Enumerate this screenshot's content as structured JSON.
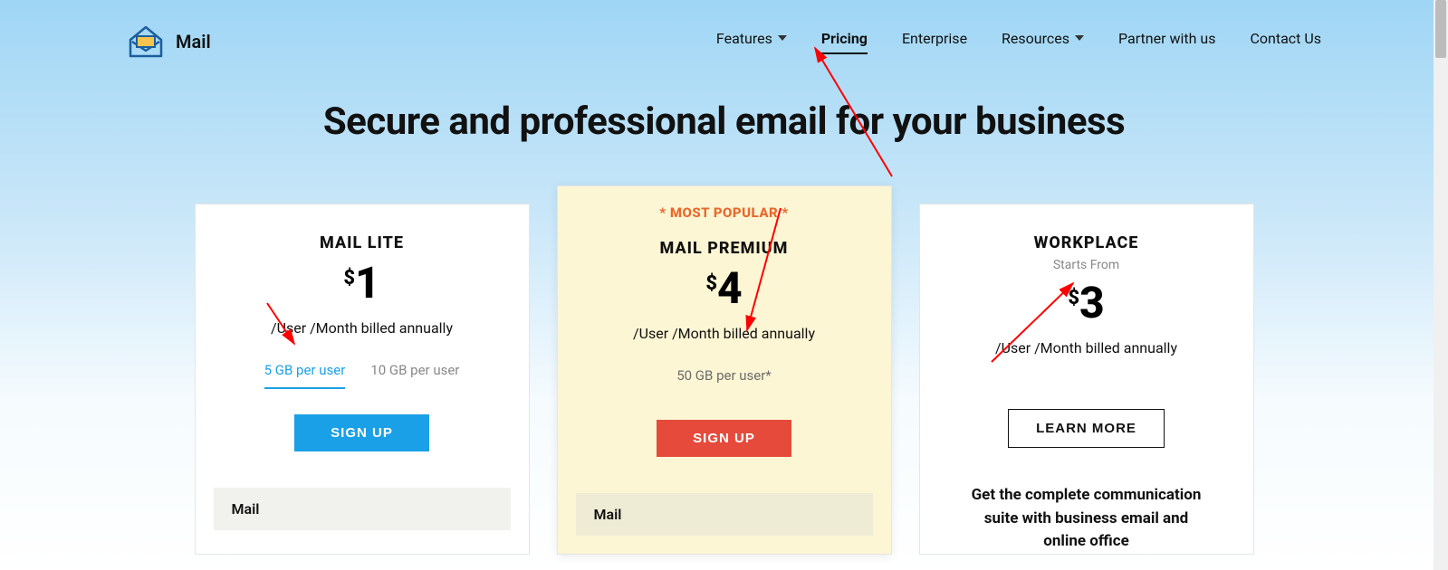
{
  "brand": {
    "name": "Mail"
  },
  "nav": {
    "features": "Features",
    "pricing": "Pricing",
    "enterprise": "Enterprise",
    "resources": "Resources",
    "partner": "Partner with us",
    "contact": "Contact Us"
  },
  "headline": "Secure and professional email for your business",
  "plans": {
    "lite": {
      "name": "MAIL LITE",
      "currency": "$",
      "price": "1",
      "billing": "/User /Month billed annually",
      "tier_a": "5 GB per user",
      "tier_b": "10 GB per user",
      "cta": "SIGN UP",
      "feature_head": "Mail"
    },
    "premium": {
      "badge": "* MOST POPULAR *",
      "name": "MAIL PREMIUM",
      "currency": "$",
      "price": "4",
      "billing": "/User /Month billed annually",
      "storage": "50 GB per user*",
      "cta": "SIGN UP",
      "feature_head": "Mail"
    },
    "workplace": {
      "name": "WORKPLACE",
      "subtext": "Starts From",
      "currency": "$",
      "price": "3",
      "billing": "/User /Month billed annually",
      "cta": "LEARN MORE",
      "desc": "Get the complete communication suite with business email and online office"
    }
  }
}
